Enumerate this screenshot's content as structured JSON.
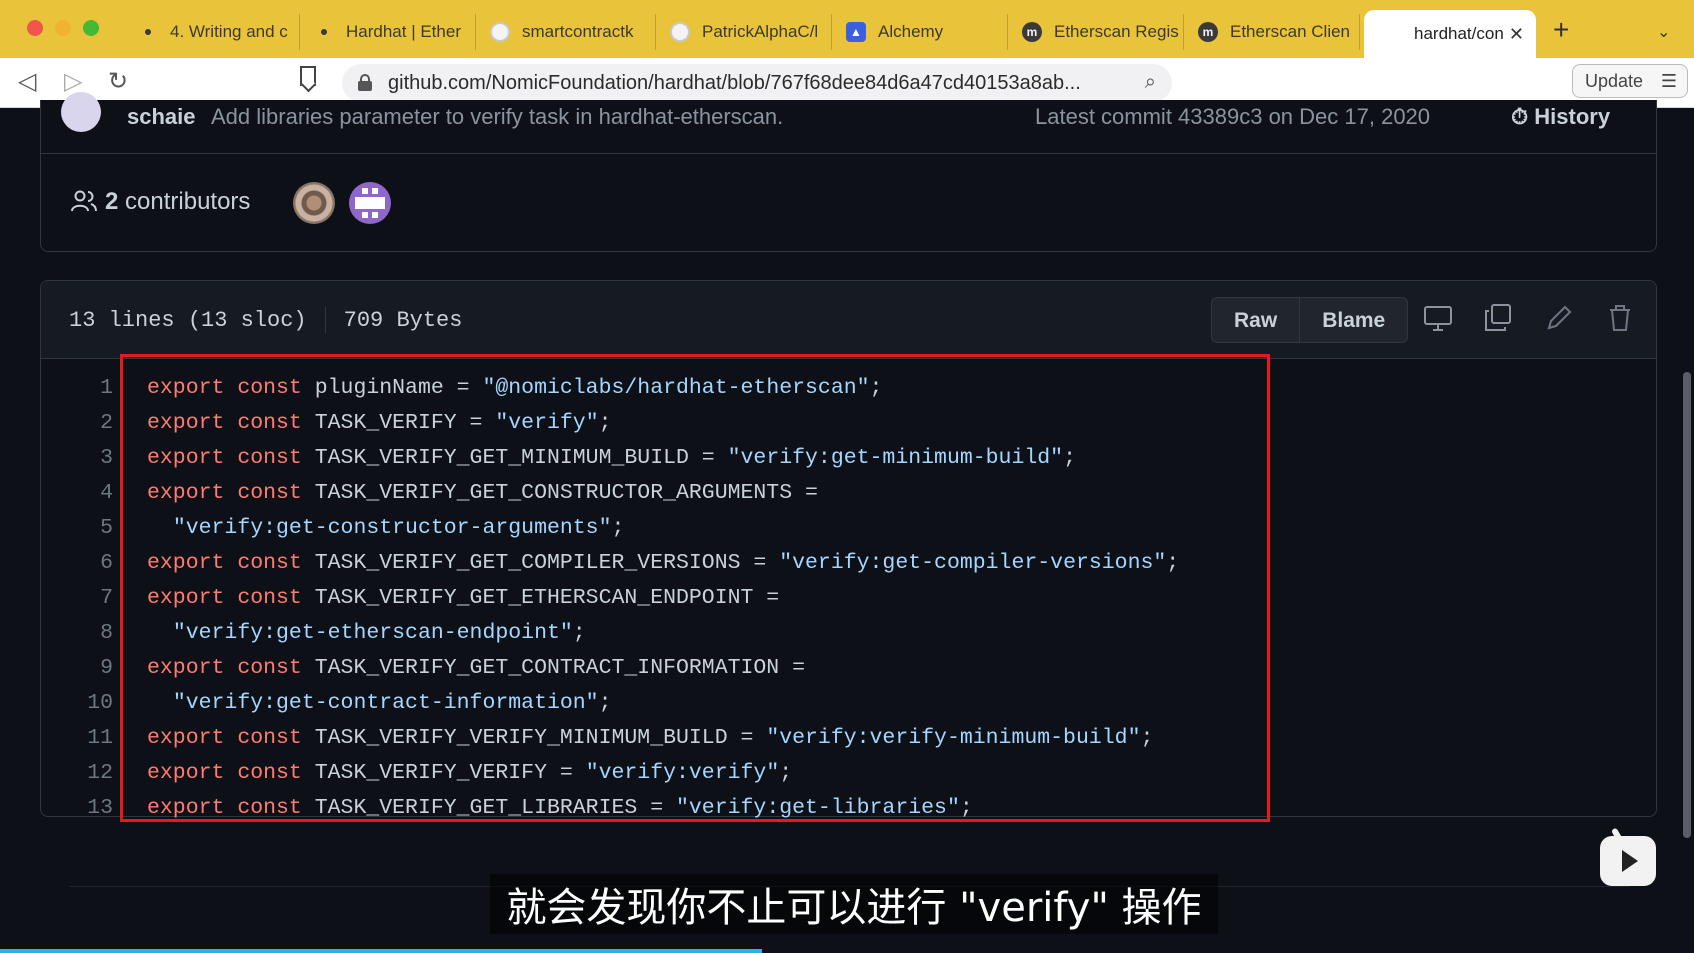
{
  "browser": {
    "tabs": [
      {
        "title": "4. Writing and c",
        "icon": "dot-icon"
      },
      {
        "title": "Hardhat | Ether",
        "icon": "dot-icon"
      },
      {
        "title": "smartcontractk",
        "icon": "github-icon"
      },
      {
        "title": "PatrickAlphaC/l",
        "icon": "github-icon"
      },
      {
        "title": "Alchemy",
        "icon": "alchemy-icon"
      },
      {
        "title": "Etherscan Regis",
        "icon": "etherscan-icon"
      },
      {
        "title": "Etherscan Clien",
        "icon": "etherscan-icon"
      },
      {
        "title": "hardhat/con",
        "icon": "github-icon",
        "active": true
      }
    ],
    "new_tab": "+",
    "tab_close": "✕",
    "url": "github.com/NomicFoundation/hardhat/blob/767f68dee84d6a47cd40153a8ab...",
    "update_button": "Update"
  },
  "commit": {
    "author": "schaie",
    "message": "Add libraries parameter to verify task in hardhat-etherscan.",
    "latest": "Latest commit 43389c3 on Dec 17, 2020",
    "history": "History"
  },
  "contributors": {
    "count": "2",
    "label": "contributors"
  },
  "file": {
    "lines_info": "13 lines (13 sloc)",
    "size": "709 Bytes",
    "raw_label": "Raw",
    "blame_label": "Blame"
  },
  "code_lines": [
    {
      "n": "1",
      "kw": "export const ",
      "id": "pluginName = ",
      "str": "\"@nomiclabs/hardhat-etherscan\"",
      "end": ";"
    },
    {
      "n": "2",
      "kw": "export const ",
      "id": "TASK_VERIFY = ",
      "str": "\"verify\"",
      "end": ";"
    },
    {
      "n": "3",
      "kw": "export const ",
      "id": "TASK_VERIFY_GET_MINIMUM_BUILD = ",
      "str": "\"verify:get-minimum-build\"",
      "end": ";"
    },
    {
      "n": "4",
      "kw": "export const ",
      "id": "TASK_VERIFY_GET_CONSTRUCTOR_ARGUMENTS =",
      "str": "",
      "end": ""
    },
    {
      "n": "5",
      "kw": "",
      "id": "  ",
      "str": "\"verify:get-constructor-arguments\"",
      "end": ";"
    },
    {
      "n": "6",
      "kw": "export const ",
      "id": "TASK_VERIFY_GET_COMPILER_VERSIONS = ",
      "str": "\"verify:get-compiler-versions\"",
      "end": ";"
    },
    {
      "n": "7",
      "kw": "export const ",
      "id": "TASK_VERIFY_GET_ETHERSCAN_ENDPOINT =",
      "str": "",
      "end": ""
    },
    {
      "n": "8",
      "kw": "",
      "id": "  ",
      "str": "\"verify:get-etherscan-endpoint\"",
      "end": ";"
    },
    {
      "n": "9",
      "kw": "export const ",
      "id": "TASK_VERIFY_GET_CONTRACT_INFORMATION =",
      "str": "",
      "end": ""
    },
    {
      "n": "10",
      "kw": "",
      "id": "  ",
      "str": "\"verify:get-contract-information\"",
      "end": ";"
    },
    {
      "n": "11",
      "kw": "export const ",
      "id": "TASK_VERIFY_VERIFY_MINIMUM_BUILD = ",
      "str": "\"verify:verify-minimum-build\"",
      "end": ";"
    },
    {
      "n": "12",
      "kw": "export const ",
      "id": "TASK_VERIFY_VERIFY = ",
      "str": "\"verify:verify\"",
      "end": ";"
    },
    {
      "n": "13",
      "kw": "export const ",
      "id": "TASK_VERIFY_GET_LIBRARIES = ",
      "str": "\"verify:get-libraries\"",
      "end": ";"
    }
  ],
  "subtitle": "就会发现你不止可以进行 \"verify\" 操作",
  "colors": {
    "keyword": "#ff7b72",
    "string": "#a5d6ff",
    "highlight_border": "#e8191b",
    "tabbar": "#e9c43a"
  },
  "video_progress": 0.45
}
